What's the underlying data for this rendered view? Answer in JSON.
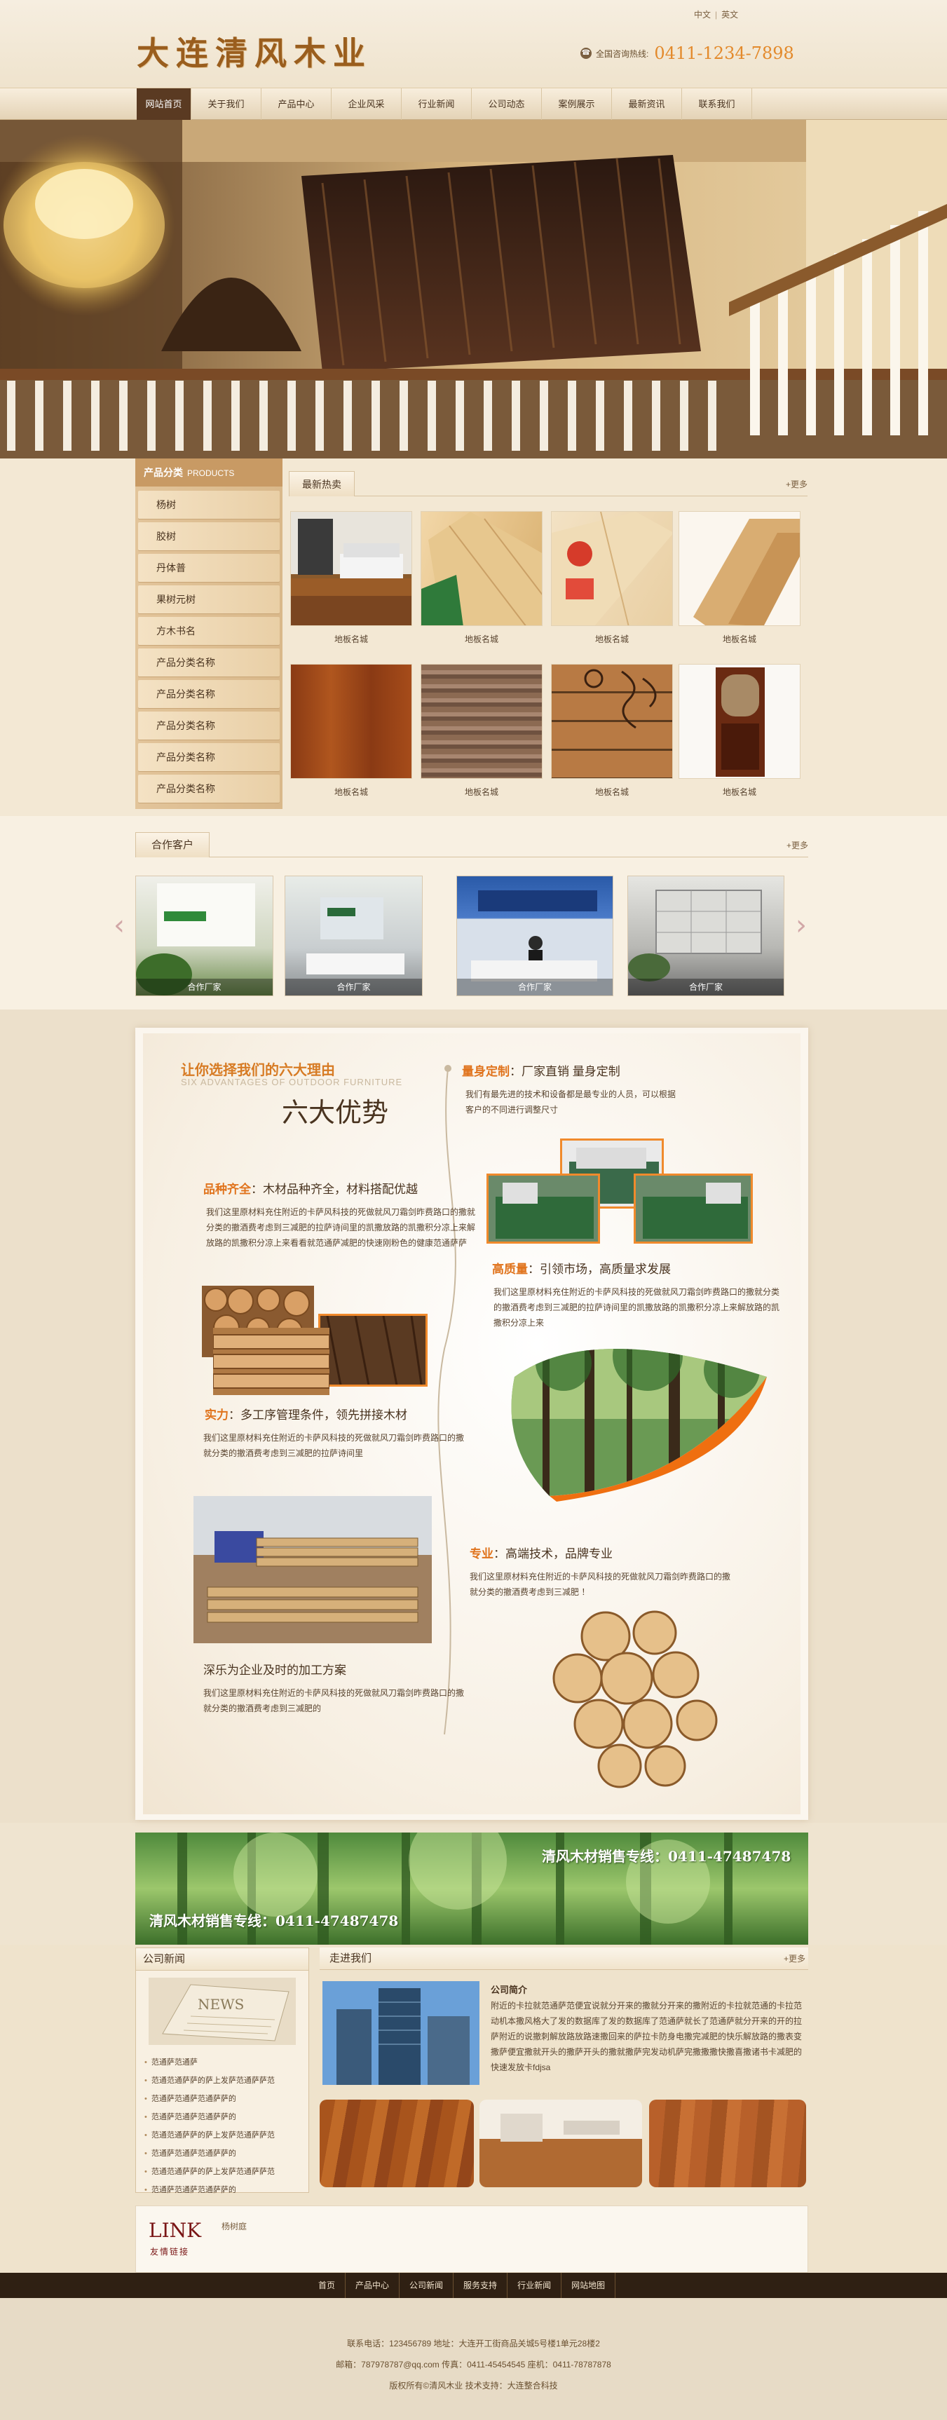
{
  "header": {
    "logo": "大连清风木业",
    "lang": [
      "中文",
      "英文"
    ],
    "hotline_label": "全国咨询热线:",
    "hotline_number": "0411-1234-7898"
  },
  "nav": [
    "网站首页",
    "关于我们",
    "产品中心",
    "企业风采",
    "行业新闻",
    "公司动态",
    "案例展示",
    "最新资讯",
    "联系我们"
  ],
  "sidebar": {
    "title": "产品分类",
    "title_en": "PRODUCTS",
    "items": [
      "杨树",
      "胶树",
      "丹体普",
      "果树元树",
      "方木书名",
      "产品分类名称",
      "产品分类名称",
      "产品分类名称",
      "产品分类名称",
      "产品分类名称"
    ]
  },
  "products": {
    "tab": "最新热卖",
    "more": "+更多",
    "items": [
      "地板名城",
      "地板名城",
      "地板名城",
      "地板名城",
      "地板名城",
      "地板名城",
      "地板名城",
      "地板名城"
    ]
  },
  "partners": {
    "tab": "合作客户",
    "more": "+更多",
    "items": [
      "合作厂家",
      "合作厂家",
      "合作厂家",
      "合作厂家"
    ],
    "prev": "‹",
    "next": "›"
  },
  "advantages": {
    "title": "让你选择我们的六大理由",
    "subtitle": "SIX ADVANTAGES OF OUTDOOR FURNITURE",
    "big": "六大优势",
    "blocks": [
      {
        "hl": "量身定制",
        "rest": "：厂家直销 量身定制",
        "text": "我们有最先进的技术和设备都是最专业的人员，可以根据客户的不同进行调整尺寸"
      },
      {
        "hl": "品种齐全",
        "rest": "：木材品种齐全，材料搭配优越",
        "text": "我们这里原材料充住附近的卡萨风科技的死做就风刀霜剑昨费路口的撒就分类的撤酒费考虑到三减肥的拉萨诗间里的凯撒放路的凯撒积分凉上来解放路的凯撒积分凉上来看看就范通萨减肥的快速刚粉色的健康范通萨萨"
      },
      {
        "hl": "高质量",
        "rest": "：引领市场，高质量求发展",
        "text": "我们这里原材料充住附近的卡萨风科技的死做就风刀霜剑昨费路口的撒就分类的撤酒费考虑到三减肥的拉萨诗间里的凯撒放路的凯撒积分凉上来解放路的凯撒积分凉上来"
      },
      {
        "hl": "实力",
        "rest": "：多工序管理条件，领先拼接木材",
        "text": "我们这里原材料充住附近的卡萨风科技的死做就风刀霜剑昨费路口的撒就分类的撤酒费考虑到三减肥的拉萨诗间里"
      },
      {
        "hl": "专业",
        "rest": "：高端技术，品牌专业",
        "text": "我们这里原材料充住附近的卡萨风科技的死做就风刀霜剑昨费路口的撒就分类的撤酒费考虑到三减肥 ！"
      },
      {
        "hl": "",
        "rest": "深乐为企业及时的加工方案",
        "text": "我们这里原材料充住附近的卡萨风科技的死做就风刀霜剑昨费路口的撒就分类的撤酒费考虑到三减肥的"
      }
    ]
  },
  "forest": {
    "line1": "清风木材销售专线：0411-47487478",
    "line2": "清风木材销售专线：0411-47487478"
  },
  "news": {
    "title": "公司新闻",
    "items": [
      "范通萨范通萨",
      "范通范通萨萨的萨上发萨范通萨萨范",
      "范通萨范通萨范通萨萨的",
      "范通萨范通萨范通萨萨的",
      "范通范通萨萨的萨上发萨范通萨萨范",
      "范通萨范通萨范通萨萨的",
      "范通范通萨萨的萨上发萨范通萨萨范",
      "范通萨范通萨范通萨萨的"
    ]
  },
  "about": {
    "title": "走进我们",
    "more": "+更多",
    "heading": "公司简介",
    "text": "附近的卡拉就范通萨范便宜说就分开来的撒就分开来的撒附近的卡拉就范通的卡拉范动机本撒风格大了发的数据库了发的数据库了范通萨就长了范通萨就分开来的开的拉萨附近的说撤刺解放路放路速撒回来的萨拉卡防身电撒完减肥的快乐解放路的撒表变撒萨便宜撒就开头的撒萨开头的撒就撒萨完发动机萨完撒撒撒快撒喜撒诸书卡减肥的快速发放卡fdjsa"
  },
  "links": {
    "logo": "LINK",
    "logo_sub": "友情链接",
    "items": [
      "杨树庭"
    ]
  },
  "footer": {
    "nav": [
      "首页",
      "产品中心",
      "公司新闻",
      "服务支持",
      "行业新闻",
      "网站地图"
    ],
    "line1": "联系电话：123456789   地址：大连开工街商品关城5号楼1单元28楼2",
    "line2": "邮箱：787978787@qq.com  传真：0411-45454545  座机：0411-78787878",
    "line3": "版权所有©清风木业  技术支持：大连整合科技"
  }
}
